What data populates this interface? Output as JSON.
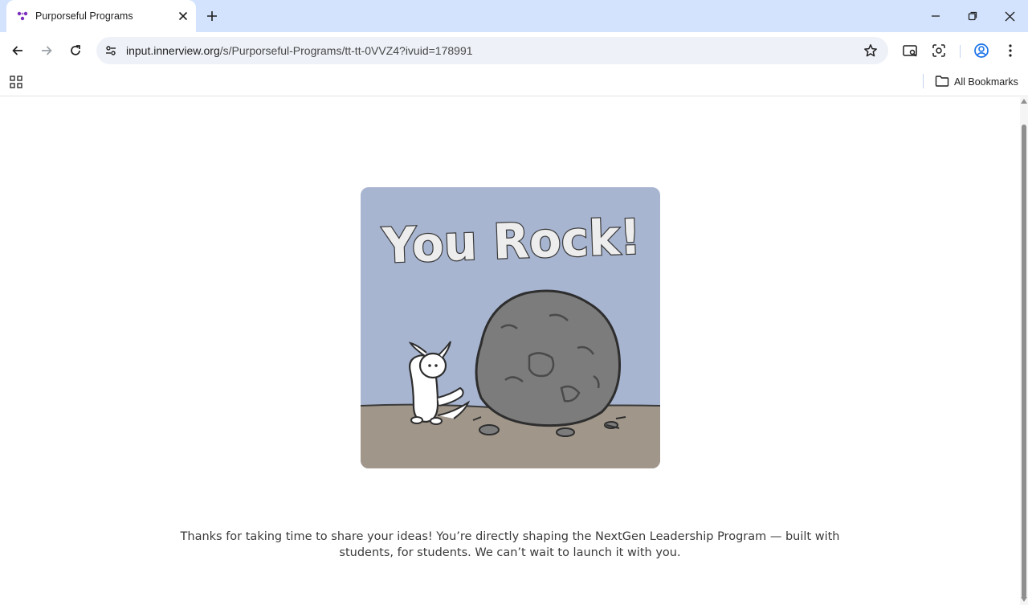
{
  "browser": {
    "tab": {
      "title": "Purporseful Programs"
    },
    "address_bar": {
      "url_host": "input.innerview.org",
      "url_path": "/s/Purporseful-Programs/tt-tt-0VVZ4?ivuid=178991"
    },
    "bookmarks_bar": {
      "all_bookmarks_label": "All Bookmarks"
    },
    "icons": {
      "tab_favicon": "innerview-logo-icon",
      "close_tab": "close-icon",
      "new_tab": "plus-icon",
      "back": "arrow-left-icon",
      "forward": "arrow-right-icon",
      "reload": "reload-icon",
      "site_info": "tune-icon",
      "bookmark": "star-icon",
      "reading_mode": "reading-mode-icon",
      "lens": "lens-icon",
      "profile": "profile-icon",
      "menu": "kebab-icon",
      "apps": "apps-grid-icon",
      "folder": "folder-icon",
      "minimize": "minimize-icon",
      "restore": "restore-icon",
      "close_window": "close-icon"
    },
    "colors": {
      "tabbar": "#d3e3fd",
      "omnibox": "#eef2f8",
      "accent": "#1a73e8",
      "favicon": "#7b2fbe"
    }
  },
  "page": {
    "illustration": {
      "heading": "You Rock!",
      "colors": {
        "sky": "#a8b5d1",
        "ground": "#a0968a",
        "rock": "#7c7c7c"
      }
    },
    "message_line1": "Thanks for taking  time to share your ideas! You’re directly shaping the NextGen Leadership Program — built with",
    "message_line2": "students, for students. We can’t wait to launch it with you."
  }
}
